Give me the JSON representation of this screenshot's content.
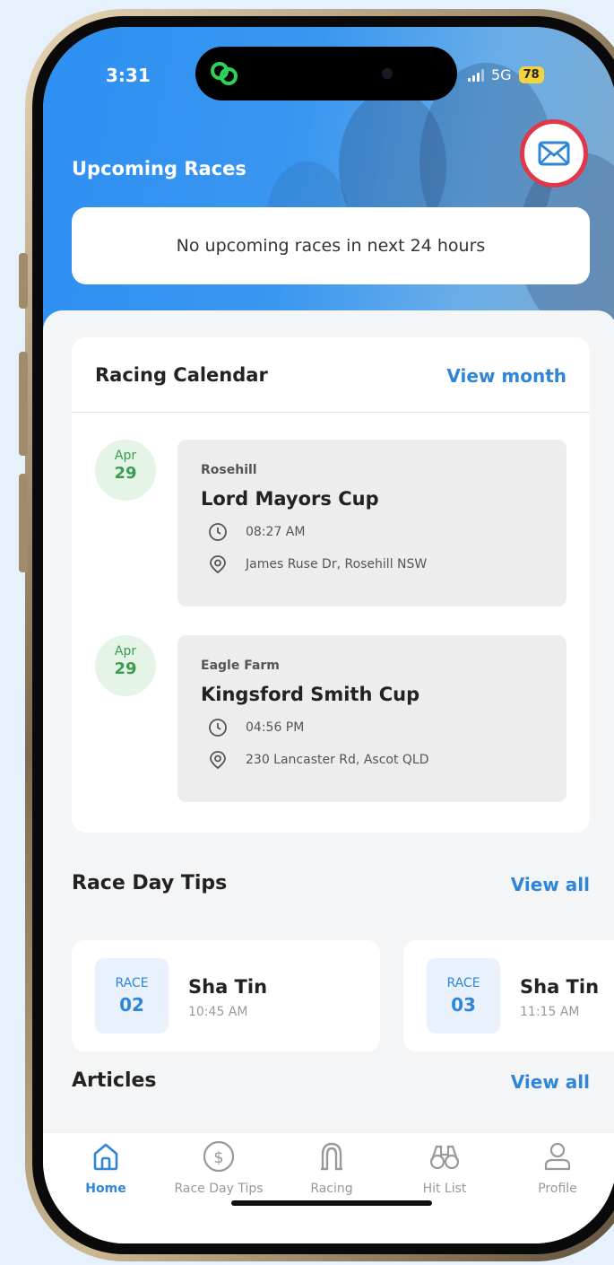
{
  "status_bar": {
    "time": "3:31",
    "network": "5G",
    "battery": "78",
    "app_icon": "link-icon"
  },
  "header": {
    "title": "Upcoming Races",
    "mail_icon": "mail-icon",
    "upcoming_message": "No upcoming races in next 24 hours"
  },
  "calendar": {
    "title": "Racing Calendar",
    "view_label": "View month",
    "events": [
      {
        "month": "Apr",
        "day": "29",
        "venue": "Rosehill",
        "name": "Lord Mayors Cup",
        "time": "08:27 AM",
        "address": "James Ruse Dr, Rosehill NSW"
      },
      {
        "month": "Apr",
        "day": "29",
        "venue": "Eagle Farm",
        "name": "Kingsford Smith Cup",
        "time": "04:56 PM",
        "address": "230 Lancaster Rd, Ascot QLD"
      }
    ]
  },
  "tips": {
    "title": "Race Day Tips",
    "view_label": "View all",
    "items": [
      {
        "label": "RACE",
        "number": "02",
        "venue": "Sha Tin",
        "time": "10:45 AM"
      },
      {
        "label": "RACE",
        "number": "03",
        "venue": "Sha Tin",
        "time": "11:15 AM"
      }
    ]
  },
  "articles": {
    "title": "Articles",
    "view_label": "View all"
  },
  "tabbar": {
    "items": [
      {
        "label": "Home",
        "icon": "home-icon",
        "active": true
      },
      {
        "label": "Race Day Tips",
        "icon": "dollar-icon",
        "active": false
      },
      {
        "label": "Racing",
        "icon": "horseshoe-icon",
        "active": false
      },
      {
        "label": "Hit List",
        "icon": "binoculars-icon",
        "active": false
      },
      {
        "label": "Profile",
        "icon": "user-icon",
        "active": false
      }
    ]
  },
  "colors": {
    "accent": "#2f86d8",
    "header_blue": "#2d8ff2",
    "date_green": "#3a9c4e",
    "highlight_red": "#e0374a",
    "battery_yellow": "#f3d23c"
  }
}
